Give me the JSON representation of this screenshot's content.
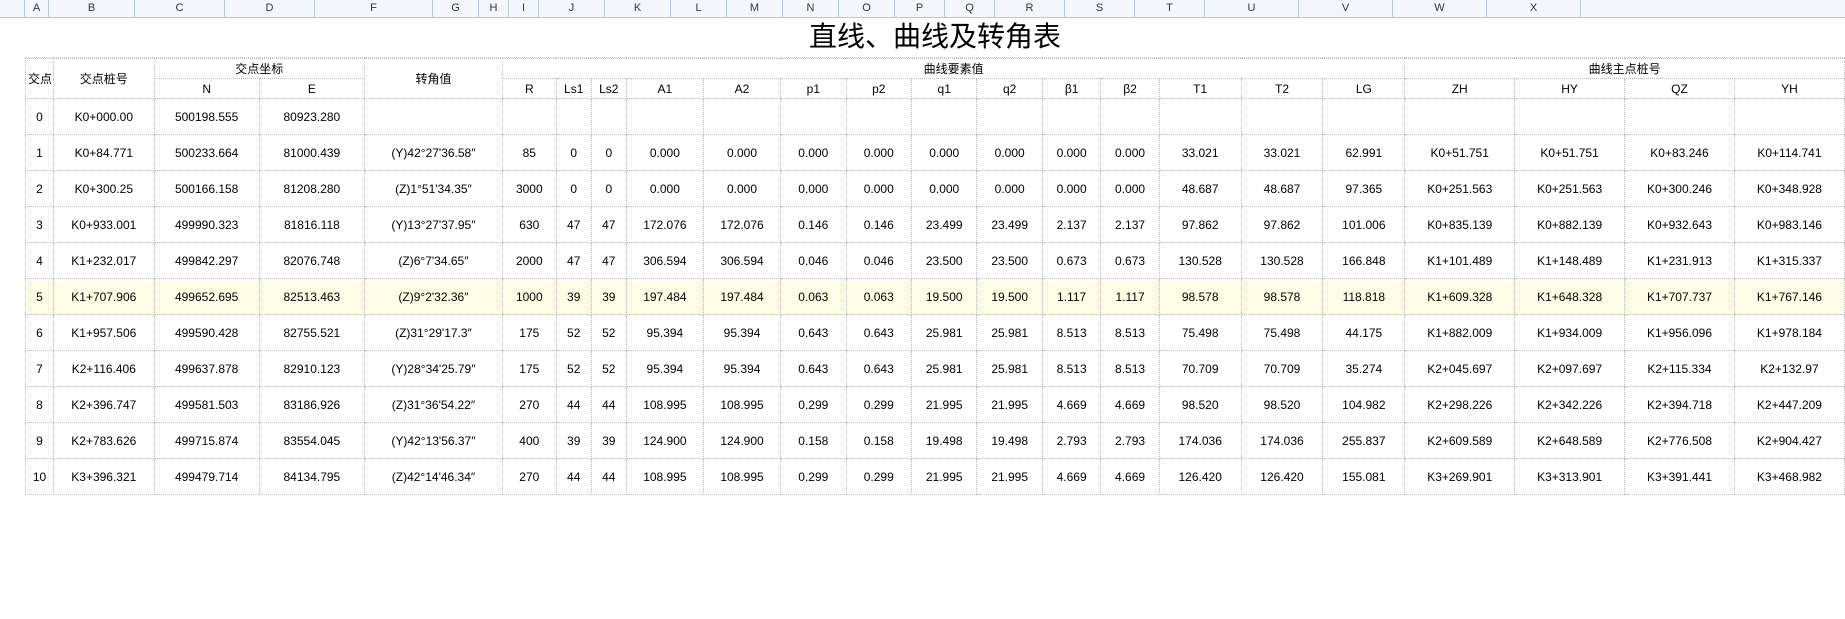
{
  "column_letters": [
    "A",
    "B",
    "C",
    "D",
    "F",
    "G",
    "H",
    "I",
    "J",
    "K",
    "L",
    "M",
    "N",
    "O",
    "P",
    "Q",
    "R",
    "S",
    "T",
    "U",
    "V",
    "W",
    "X"
  ],
  "title": "直线、曲线及转角表",
  "headers": {
    "jd": "交点",
    "zh": "交点桩号",
    "coord_group": "交点坐标",
    "N": "N",
    "E": "E",
    "angle": "转角值",
    "curve_group": "曲线要素值",
    "R": "R",
    "Ls1": "Ls1",
    "Ls2": "Ls2",
    "A1": "A1",
    "A2": "A2",
    "p1": "p1",
    "p2": "p2",
    "q1": "q1",
    "q2": "q2",
    "b1": "β1",
    "b2": "β2",
    "T1": "T1",
    "T2": "T2",
    "LG": "LG",
    "main_group": "曲线主点桩号",
    "ZH": "ZH",
    "HY": "HY",
    "QZ": "QZ",
    "YH": "YH"
  },
  "rows": [
    {
      "i": "0",
      "zh": "K0+000.00",
      "N": "500198.555",
      "E": "80923.280",
      "ang": "",
      "R": "",
      "Ls1": "",
      "Ls2": "",
      "A1": "",
      "A2": "",
      "p1": "",
      "p2": "",
      "q1": "",
      "q2": "",
      "b1": "",
      "b2": "",
      "T1": "",
      "T2": "",
      "LG": "",
      "ZH": "",
      "HY": "",
      "QZ": "",
      "YH": ""
    },
    {
      "i": "1",
      "zh": "K0+84.771",
      "N": "500233.664",
      "E": "81000.439",
      "ang": "(Y)42°27'36.58″",
      "R": "85",
      "Ls1": "0",
      "Ls2": "0",
      "A1": "0.000",
      "A2": "0.000",
      "p1": "0.000",
      "p2": "0.000",
      "q1": "0.000",
      "q2": "0.000",
      "b1": "0.000",
      "b2": "0.000",
      "T1": "33.021",
      "T2": "33.021",
      "LG": "62.991",
      "ZH": "K0+51.751",
      "HY": "K0+51.751",
      "QZ": "K0+83.246",
      "YH": "K0+114.741"
    },
    {
      "i": "2",
      "zh": "K0+300.25",
      "N": "500166.158",
      "E": "81208.280",
      "ang": "(Z)1°51'34.35″",
      "R": "3000",
      "Ls1": "0",
      "Ls2": "0",
      "A1": "0.000",
      "A2": "0.000",
      "p1": "0.000",
      "p2": "0.000",
      "q1": "0.000",
      "q2": "0.000",
      "b1": "0.000",
      "b2": "0.000",
      "T1": "48.687",
      "T2": "48.687",
      "LG": "97.365",
      "ZH": "K0+251.563",
      "HY": "K0+251.563",
      "QZ": "K0+300.246",
      "YH": "K0+348.928"
    },
    {
      "i": "3",
      "zh": "K0+933.001",
      "N": "499990.323",
      "E": "81816.118",
      "ang": "(Y)13°27'37.95″",
      "R": "630",
      "Ls1": "47",
      "Ls2": "47",
      "A1": "172.076",
      "A2": "172.076",
      "p1": "0.146",
      "p2": "0.146",
      "q1": "23.499",
      "q2": "23.499",
      "b1": "2.137",
      "b2": "2.137",
      "T1": "97.862",
      "T2": "97.862",
      "LG": "101.006",
      "ZH": "K0+835.139",
      "HY": "K0+882.139",
      "QZ": "K0+932.643",
      "YH": "K0+983.146"
    },
    {
      "i": "4",
      "zh": "K1+232.017",
      "N": "499842.297",
      "E": "82076.748",
      "ang": "(Z)6°7'34.65″",
      "R": "2000",
      "Ls1": "47",
      "Ls2": "47",
      "A1": "306.594",
      "A2": "306.594",
      "p1": "0.046",
      "p2": "0.046",
      "q1": "23.500",
      "q2": "23.500",
      "b1": "0.673",
      "b2": "0.673",
      "T1": "130.528",
      "T2": "130.528",
      "LG": "166.848",
      "ZH": "K1+101.489",
      "HY": "K1+148.489",
      "QZ": "K1+231.913",
      "YH": "K1+315.337"
    },
    {
      "i": "5",
      "zh": "K1+707.906",
      "N": "499652.695",
      "E": "82513.463",
      "ang": "(Z)9°2'32.36″",
      "R": "1000",
      "Ls1": "39",
      "Ls2": "39",
      "A1": "197.484",
      "A2": "197.484",
      "p1": "0.063",
      "p2": "0.063",
      "q1": "19.500",
      "q2": "19.500",
      "b1": "1.117",
      "b2": "1.117",
      "T1": "98.578",
      "T2": "98.578",
      "LG": "118.818",
      "ZH": "K1+609.328",
      "HY": "K1+648.328",
      "QZ": "K1+707.737",
      "YH": "K1+767.146"
    },
    {
      "i": "6",
      "zh": "K1+957.506",
      "N": "499590.428",
      "E": "82755.521",
      "ang": "(Z)31°29'17.3″",
      "R": "175",
      "Ls1": "52",
      "Ls2": "52",
      "A1": "95.394",
      "A2": "95.394",
      "p1": "0.643",
      "p2": "0.643",
      "q1": "25.981",
      "q2": "25.981",
      "b1": "8.513",
      "b2": "8.513",
      "T1": "75.498",
      "T2": "75.498",
      "LG": "44.175",
      "ZH": "K1+882.009",
      "HY": "K1+934.009",
      "QZ": "K1+956.096",
      "YH": "K1+978.184"
    },
    {
      "i": "7",
      "zh": "K2+116.406",
      "N": "499637.878",
      "E": "82910.123",
      "ang": "(Y)28°34'25.79″",
      "R": "175",
      "Ls1": "52",
      "Ls2": "52",
      "A1": "95.394",
      "A2": "95.394",
      "p1": "0.643",
      "p2": "0.643",
      "q1": "25.981",
      "q2": "25.981",
      "b1": "8.513",
      "b2": "8.513",
      "T1": "70.709",
      "T2": "70.709",
      "LG": "35.274",
      "ZH": "K2+045.697",
      "HY": "K2+097.697",
      "QZ": "K2+115.334",
      "YH": "K2+132.97"
    },
    {
      "i": "8",
      "zh": "K2+396.747",
      "N": "499581.503",
      "E": "83186.926",
      "ang": "(Z)31°36'54.22″",
      "R": "270",
      "Ls1": "44",
      "Ls2": "44",
      "A1": "108.995",
      "A2": "108.995",
      "p1": "0.299",
      "p2": "0.299",
      "q1": "21.995",
      "q2": "21.995",
      "b1": "4.669",
      "b2": "4.669",
      "T1": "98.520",
      "T2": "98.520",
      "LG": "104.982",
      "ZH": "K2+298.226",
      "HY": "K2+342.226",
      "QZ": "K2+394.718",
      "YH": "K2+447.209"
    },
    {
      "i": "9",
      "zh": "K2+783.626",
      "N": "499715.874",
      "E": "83554.045",
      "ang": "(Y)42°13'56.37″",
      "R": "400",
      "Ls1": "39",
      "Ls2": "39",
      "A1": "124.900",
      "A2": "124.900",
      "p1": "0.158",
      "p2": "0.158",
      "q1": "19.498",
      "q2": "19.498",
      "b1": "2.793",
      "b2": "2.793",
      "T1": "174.036",
      "T2": "174.036",
      "LG": "255.837",
      "ZH": "K2+609.589",
      "HY": "K2+648.589",
      "QZ": "K2+776.508",
      "YH": "K2+904.427"
    },
    {
      "i": "10",
      "zh": "K3+396.321",
      "N": "499479.714",
      "E": "84134.795",
      "ang": "(Z)42°14'46.34″",
      "R": "270",
      "Ls1": "44",
      "Ls2": "44",
      "A1": "108.995",
      "A2": "108.995",
      "p1": "0.299",
      "p2": "0.299",
      "q1": "21.995",
      "q2": "21.995",
      "b1": "4.669",
      "b2": "4.669",
      "T1": "126.420",
      "T2": "126.420",
      "LG": "155.081",
      "ZH": "K3+269.901",
      "HY": "K3+313.901",
      "QZ": "K3+391.441",
      "YH": "K3+468.982"
    }
  ],
  "chart_data": {
    "type": "table",
    "title": "直线、曲线及转角表",
    "columns": [
      "交点",
      "交点桩号",
      "N",
      "E",
      "转角值",
      "R",
      "Ls1",
      "Ls2",
      "A1",
      "A2",
      "p1",
      "p2",
      "q1",
      "q2",
      "β1",
      "β2",
      "T1",
      "T2",
      "LG",
      "ZH",
      "HY",
      "QZ",
      "YH"
    ],
    "rows": [
      [
        "0",
        "K0+000.00",
        "500198.555",
        "80923.280",
        "",
        "",
        "",
        "",
        "",
        "",
        "",
        "",
        "",
        "",
        "",
        "",
        "",
        "",
        "",
        "",
        "",
        "",
        ""
      ],
      [
        "1",
        "K0+84.771",
        "500233.664",
        "81000.439",
        "(Y)42°27'36.58″",
        "85",
        "0",
        "0",
        "0.000",
        "0.000",
        "0.000",
        "0.000",
        "0.000",
        "0.000",
        "0.000",
        "0.000",
        "33.021",
        "33.021",
        "62.991",
        "K0+51.751",
        "K0+51.751",
        "K0+83.246",
        "K0+114.741"
      ],
      [
        "2",
        "K0+300.25",
        "500166.158",
        "81208.280",
        "(Z)1°51'34.35″",
        "3000",
        "0",
        "0",
        "0.000",
        "0.000",
        "0.000",
        "0.000",
        "0.000",
        "0.000",
        "0.000",
        "0.000",
        "48.687",
        "48.687",
        "97.365",
        "K0+251.563",
        "K0+251.563",
        "K0+300.246",
        "K0+348.928"
      ],
      [
        "3",
        "K0+933.001",
        "499990.323",
        "81816.118",
        "(Y)13°27'37.95″",
        "630",
        "47",
        "47",
        "172.076",
        "172.076",
        "0.146",
        "0.146",
        "23.499",
        "23.499",
        "2.137",
        "2.137",
        "97.862",
        "97.862",
        "101.006",
        "K0+835.139",
        "K0+882.139",
        "K0+932.643",
        "K0+983.146"
      ],
      [
        "4",
        "K1+232.017",
        "499842.297",
        "82076.748",
        "(Z)6°7'34.65″",
        "2000",
        "47",
        "47",
        "306.594",
        "306.594",
        "0.046",
        "0.046",
        "23.500",
        "23.500",
        "0.673",
        "0.673",
        "130.528",
        "130.528",
        "166.848",
        "K1+101.489",
        "K1+148.489",
        "K1+231.913",
        "K1+315.337"
      ],
      [
        "5",
        "K1+707.906",
        "499652.695",
        "82513.463",
        "(Z)9°2'32.36″",
        "1000",
        "39",
        "39",
        "197.484",
        "197.484",
        "0.063",
        "0.063",
        "19.500",
        "19.500",
        "1.117",
        "1.117",
        "98.578",
        "98.578",
        "118.818",
        "K1+609.328",
        "K1+648.328",
        "K1+707.737",
        "K1+767.146"
      ],
      [
        "6",
        "K1+957.506",
        "499590.428",
        "82755.521",
        "(Z)31°29'17.3″",
        "175",
        "52",
        "52",
        "95.394",
        "95.394",
        "0.643",
        "0.643",
        "25.981",
        "25.981",
        "8.513",
        "8.513",
        "75.498",
        "75.498",
        "44.175",
        "K1+882.009",
        "K1+934.009",
        "K1+956.096",
        "K1+978.184"
      ],
      [
        "7",
        "K2+116.406",
        "499637.878",
        "82910.123",
        "(Y)28°34'25.79″",
        "175",
        "52",
        "52",
        "95.394",
        "95.394",
        "0.643",
        "0.643",
        "25.981",
        "25.981",
        "8.513",
        "8.513",
        "70.709",
        "70.709",
        "35.274",
        "K2+045.697",
        "K2+097.697",
        "K2+115.334",
        "K2+132.97"
      ],
      [
        "8",
        "K2+396.747",
        "499581.503",
        "83186.926",
        "(Z)31°36'54.22″",
        "270",
        "44",
        "44",
        "108.995",
        "108.995",
        "0.299",
        "0.299",
        "21.995",
        "21.995",
        "4.669",
        "4.669",
        "98.520",
        "98.520",
        "104.982",
        "K2+298.226",
        "K2+342.226",
        "K2+394.718",
        "K2+447.209"
      ],
      [
        "9",
        "K2+783.626",
        "499715.874",
        "83554.045",
        "(Y)42°13'56.37″",
        "400",
        "39",
        "39",
        "124.900",
        "124.900",
        "0.158",
        "0.158",
        "19.498",
        "19.498",
        "2.793",
        "2.793",
        "174.036",
        "174.036",
        "255.837",
        "K2+609.589",
        "K2+648.589",
        "K2+776.508",
        "K2+904.427"
      ],
      [
        "10",
        "K3+396.321",
        "499479.714",
        "84134.795",
        "(Z)42°14'46.34″",
        "270",
        "44",
        "44",
        "108.995",
        "108.995",
        "0.299",
        "0.299",
        "21.995",
        "21.995",
        "4.669",
        "4.669",
        "126.420",
        "126.420",
        "155.081",
        "K3+269.901",
        "K3+313.901",
        "K3+391.441",
        "K3+468.982"
      ]
    ]
  }
}
